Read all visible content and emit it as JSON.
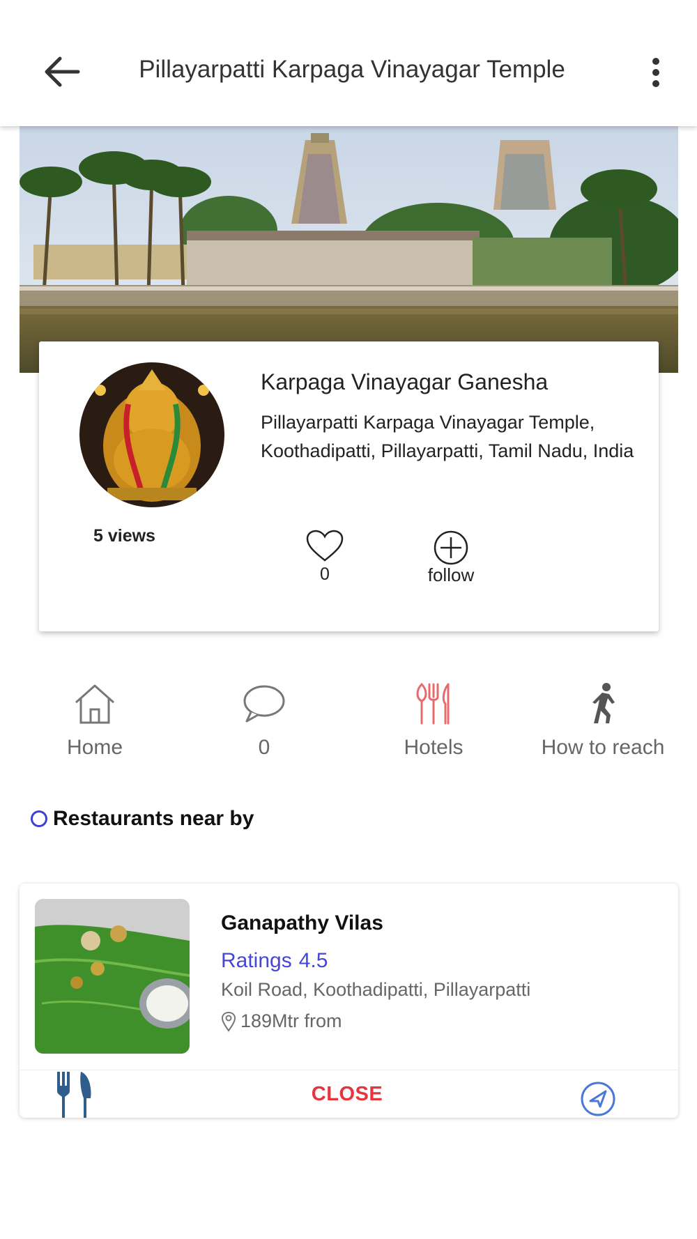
{
  "appbar": {
    "title": "Pillayarpatti Karpaga Vinayagar Temple",
    "back_icon": "arrow-left-icon",
    "more_icon": "more-vertical-icon"
  },
  "info": {
    "name": "Karpaga Vinayagar Ganesha",
    "address": "Pillayarpatti Karpaga Vinayagar Temple, Koothadipatti, Pillayarpatti, Tamil Nadu, India",
    "views": "5 views",
    "likes": "0",
    "follow_label": "follow"
  },
  "nav": {
    "items": [
      {
        "label": "Home",
        "icon": "home-icon"
      },
      {
        "label": "0",
        "icon": "comment-icon"
      },
      {
        "label": "Hotels",
        "icon": "cutlery-icon"
      },
      {
        "label": "How to reach",
        "icon": "walking-icon"
      }
    ]
  },
  "section": {
    "title": "Restaurants near by"
  },
  "restaurant": {
    "name": "Ganapathy Vilas",
    "ratings_label": "Ratings",
    "rating": "4.5",
    "address": "Koil Road, Koothadipatti, Pillayarpatti",
    "distance": "189Mtr from",
    "close_label": "CLOSE"
  },
  "colors": {
    "accent_blue": "#4646d8",
    "close_red": "#e8343a",
    "hotels_icon": "#e86b6b",
    "fork_blue": "#2f5d8c"
  }
}
